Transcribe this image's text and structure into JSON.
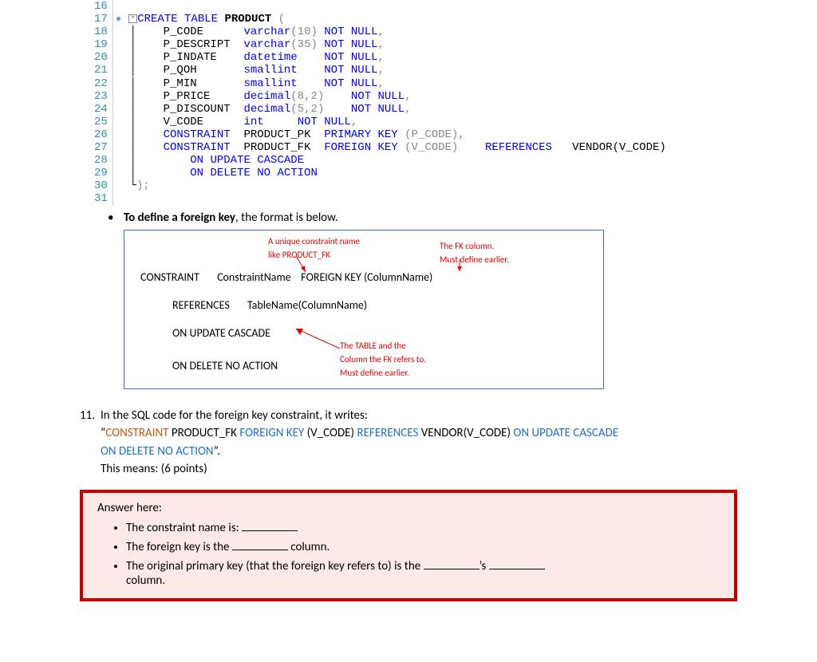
{
  "code": {
    "lines": [
      16,
      17,
      18,
      19,
      20,
      21,
      22,
      23,
      24,
      25,
      26,
      27,
      28,
      29,
      30,
      31
    ],
    "l17_kw1": "CREATE TABLE",
    "l17_kw2": "PRODUCT",
    "l17_p": " (",
    "l18_col": "P_CODE",
    "l18_type": "varchar",
    "l18_args": "(10)",
    "l18_nn": " NOT NULL",
    "l19_col": "P_DESCRIPT",
    "l19_type": "varchar",
    "l19_args": "(35)",
    "l19_nn": " NOT NULL",
    "l20_col": "P_INDATE",
    "l20_type": "datetime",
    "l20_nn": "NOT NULL",
    "l21_col": "P_QOH",
    "l21_type": "smallint",
    "l21_nn": "NOT NULL",
    "l22_col": "P_MIN",
    "l22_type": "smallint",
    "l22_nn": "NOT NULL",
    "l23_col": "P_PRICE",
    "l23_type": "decimal",
    "l23_args": "(8,2)",
    "l23_nn": "NOT NULL",
    "l24_col": "P_DISCOUNT",
    "l24_type": "decimal",
    "l24_args": "(5,2)",
    "l24_nn": "NOT NULL",
    "l25_col": "V_CODE",
    "l25_type": "int",
    "l25_nn": "NOT NULL",
    "l26_kw": "CONSTRAINT",
    "l26_name": "PRODUCT_PK",
    "l26_pk": "PRIMARY KEY",
    "l26_col": "(P_CODE)",
    "l27_kw": "CONSTRAINT",
    "l27_name": "PRODUCT_FK",
    "l27_fk": "FOREIGN KEY",
    "l27_col": "(V_CODE)",
    "l27_ref": "REFERENCES",
    "l27_tbl": "VENDOR(V_CODE)",
    "l28": "ON UPDATE CASCADE",
    "l29": "ON DELETE NO ACTION",
    "l30": ");"
  },
  "fk_bullet": "To define a foreign key",
  "fk_bullet_rest": ", the format is below.",
  "fkbox": {
    "ann1a": "A unique constraint name",
    "ann1b": "like PRODUCT_FK",
    "ann2a": "The FK column.",
    "ann2b": "Must define earlier.",
    "row1_a": "CONSTRAINT",
    "row1_b": "ConstraintName",
    "row1_c": "FOREIGN KEY (ColumnName)",
    "row2_a": "REFERENCES",
    "row2_b": "TableName(ColumnName)",
    "row3": "ON UPDATE CASCADE",
    "ann3a": "The TABLE and the",
    "ann3b": "Column the FK refers to.",
    "ann3c": "Must define earlier.",
    "row4": "ON DELETE NO ACTION"
  },
  "q11": {
    "num": "11.",
    "lead": "In the SQL code for the foreign key constraint, it writes:",
    "quote_open": "“",
    "c1": "CONSTRAINT",
    "t1": " PRODUCT_FK ",
    "c2": "FOREIGN KEY",
    "t2": " (V_CODE) ",
    "c3": "REFERENCES",
    "t3": " VENDOR(V_CODE) ",
    "c4": "ON UPDATE CASCADE",
    "c5": " ON DELETE NO ACTION",
    "quote_close": "”.",
    "means": "This means: (6 points)"
  },
  "answer": {
    "hdr": "Answer here:",
    "b1a": "The constraint name is: ",
    "b2a": "The foreign key is the ",
    "b2b": " column.",
    "b3a": "The original primary key (that the foreign key refers to) is the ",
    "b3b": "’s ",
    "b3c": "column."
  }
}
